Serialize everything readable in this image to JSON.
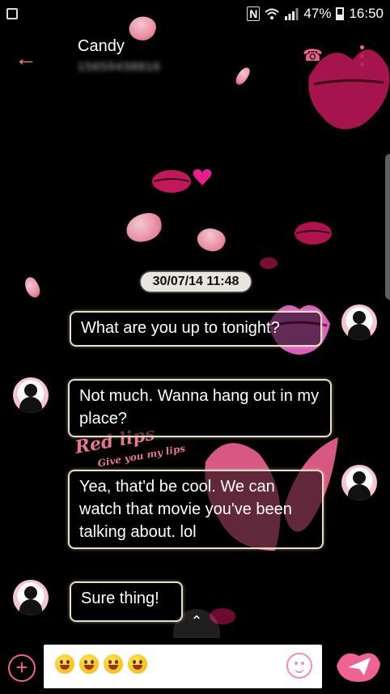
{
  "status_bar": {
    "signal": " .  . ıl",
    "battery_text": "47%",
    "time": "16:50",
    "nfc": "N"
  },
  "header": {
    "back_glyph": "←",
    "contact_name": "Candy",
    "contact_number": "15659438816",
    "call_glyph": "☎"
  },
  "conversation": {
    "date_stamp": "30/07/14 11:48",
    "messages": [
      {
        "direction": "outgoing",
        "text": "What are you up to tonight?"
      },
      {
        "direction": "incoming",
        "text": "Not much. Wanna hang out in my place?"
      },
      {
        "direction": "outgoing",
        "text": "Yea, that'd be cool. We can watch that movie you've been talking about. lol"
      },
      {
        "direction": "incoming",
        "text": "Sure thing!"
      }
    ]
  },
  "theme": {
    "watermark_title": "Red lips",
    "watermark_subtitle": "Give you my lips",
    "accent_color": "#f06292",
    "bubble_border_color": "#e7e0c5"
  },
  "composer": {
    "add_glyph": "+",
    "scroll_glyph": "⌃",
    "emoji_icons": [
      "grinning-face-icon",
      "laughing-face-icon",
      "tongue-wink-face-icon",
      "tongue-face-icon"
    ],
    "smiley_icon": "smiley-icon",
    "send_icon": "paper-plane-icon"
  }
}
